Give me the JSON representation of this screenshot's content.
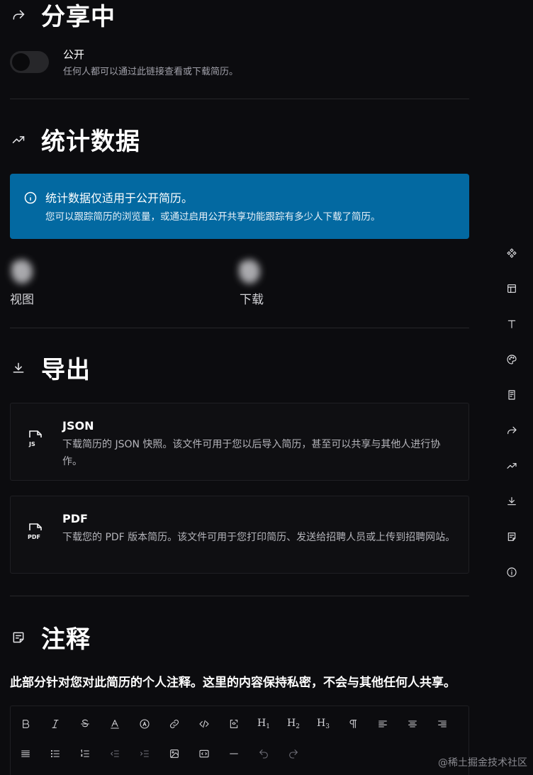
{
  "sharing": {
    "title": "分享中",
    "toggle_label": "公开",
    "toggle_desc": "任何人都可以通过此链接查看或下载简历。",
    "public": false
  },
  "statistics": {
    "title": "统计数据",
    "alert_title": "统计数据仅适用于公开简历。",
    "alert_desc": "您可以跟踪简历的浏览量，或通过启用公开共享功能跟踪有多少人下载了简历。",
    "views_value": "0",
    "views_label": "视图",
    "downloads_value": "0",
    "downloads_label": "下载"
  },
  "export": {
    "title": "导出",
    "json_title": "JSON",
    "json_desc": "下载简历的 JSON 快照。该文件可用于您以后导入简历，甚至可以共享与其他人进行协作。",
    "pdf_title": "PDF",
    "pdf_desc": "下载您的 PDF 版本简历。该文件可用于您打印简历、发送给招聘人员或上传到招聘网站。"
  },
  "notes": {
    "title": "注释",
    "desc": "此部分针对您对此简历的个人注释。这里的内容保持私密，不会与其他任何人共享。"
  },
  "toolbar": {
    "h1": "H",
    "h2": "H",
    "h3": "H",
    "h1_sub": "1",
    "h2_sub": "2",
    "h3_sub": "3"
  },
  "colors": {
    "background": "#0c0c0f",
    "alert_blue": "#0369a1"
  },
  "watermark": "@稀土掘金技术社区"
}
